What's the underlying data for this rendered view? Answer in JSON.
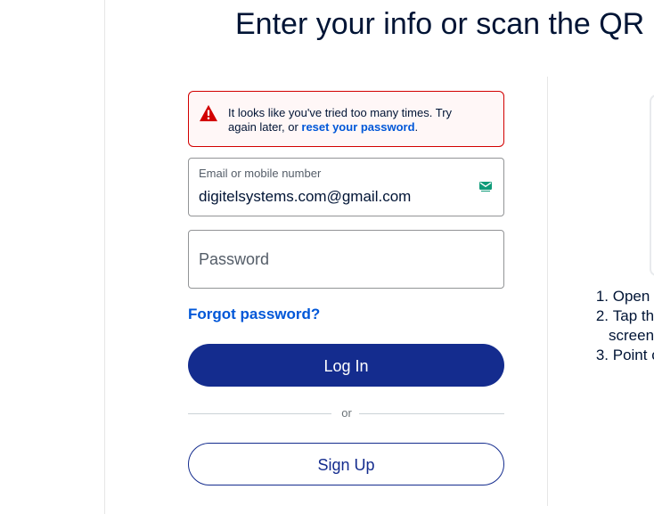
{
  "header": {
    "title": "Enter your info or scan the QR co"
  },
  "error": {
    "message_prefix": "It looks like you've tried too many times. Try again later, or ",
    "link_label": "reset your password",
    "message_suffix": "."
  },
  "login_form": {
    "email_label": "Email or mobile number",
    "email_value": "digitelsystems.com@gmail.com",
    "password_placeholder": "Password",
    "forgot_password_label": "Forgot password?",
    "login_button_label": "Log In",
    "or_text": "or",
    "signup_button_label": "Sign Up"
  },
  "qr_panel": {
    "steps": [
      {
        "number": "1.",
        "text": "Open t"
      },
      {
        "number": "2.",
        "text": "Tap th",
        "continuation": "screen"
      },
      {
        "number": "3.",
        "text": "Point c"
      }
    ]
  },
  "icons": {
    "warning": "warning-icon",
    "email": "email-icon"
  },
  "colors": {
    "primary": "#142c8e",
    "link": "#0057d8",
    "error": "#d20000",
    "text": "#001435",
    "email_icon": "#139a7a"
  }
}
